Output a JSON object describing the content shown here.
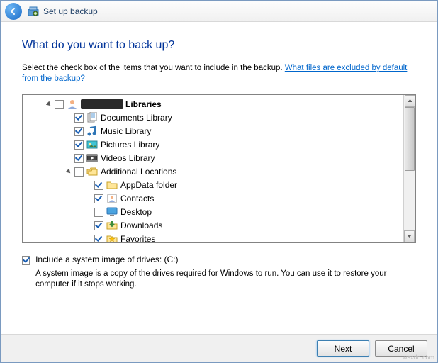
{
  "titlebar": {
    "title": "Set up backup"
  },
  "heading": "What do you want to back up?",
  "intro_text": "Select the check box of the items that you want to include in the backup. ",
  "intro_link": "What files are excluded by default from the backup?",
  "tree": {
    "root_label": "Libraries",
    "items": [
      {
        "label": "Documents Library"
      },
      {
        "label": "Music Library"
      },
      {
        "label": "Pictures Library"
      },
      {
        "label": "Videos Library"
      }
    ],
    "additional_label": "Additional Locations",
    "additional_items": [
      {
        "label": "AppData folder"
      },
      {
        "label": "Contacts"
      },
      {
        "label": "Desktop"
      },
      {
        "label": "Downloads"
      },
      {
        "label": "Favorites"
      }
    ]
  },
  "system_image": {
    "label": "Include a system image of drives: (C:)",
    "description": "A system image is a copy of the drives required for Windows to run. You can use it to restore your computer if it stops working."
  },
  "buttons": {
    "next": "Next",
    "cancel": "Cancel"
  },
  "watermark": "wsxdn.com"
}
